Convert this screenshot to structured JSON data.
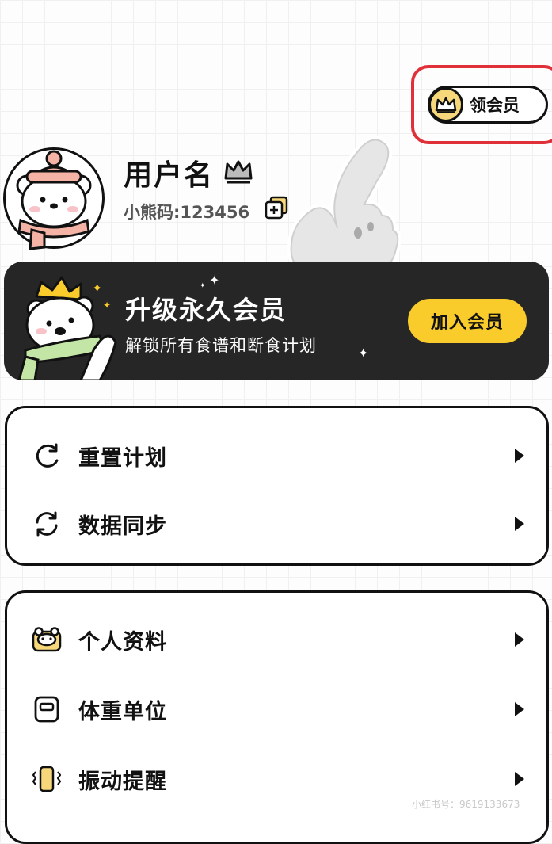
{
  "vip": {
    "label": "领会员"
  },
  "profile": {
    "username": "用户名",
    "user_code": "小熊码:123456"
  },
  "banner": {
    "title": "升级永久会员",
    "subtitle": "解锁所有食谱和断食计划",
    "join_label": "加入会员"
  },
  "menu_group_1": {
    "items": [
      {
        "label": "重置计划",
        "icon": "refresh-icon"
      },
      {
        "label": "数据同步",
        "icon": "sync-icon"
      }
    ]
  },
  "menu_group_2": {
    "items": [
      {
        "label": "个人资料",
        "icon": "bear-profile-icon"
      },
      {
        "label": "体重单位",
        "icon": "scale-icon"
      },
      {
        "label": "振动提醒",
        "icon": "vibrate-icon"
      }
    ]
  },
  "colors": {
    "accent_yellow": "#f9cb2b",
    "banner_bg": "#262626",
    "highlight_red": "#e0303a",
    "crown_gold": "#f6d87a"
  },
  "watermark": "小红书号：9619133673"
}
